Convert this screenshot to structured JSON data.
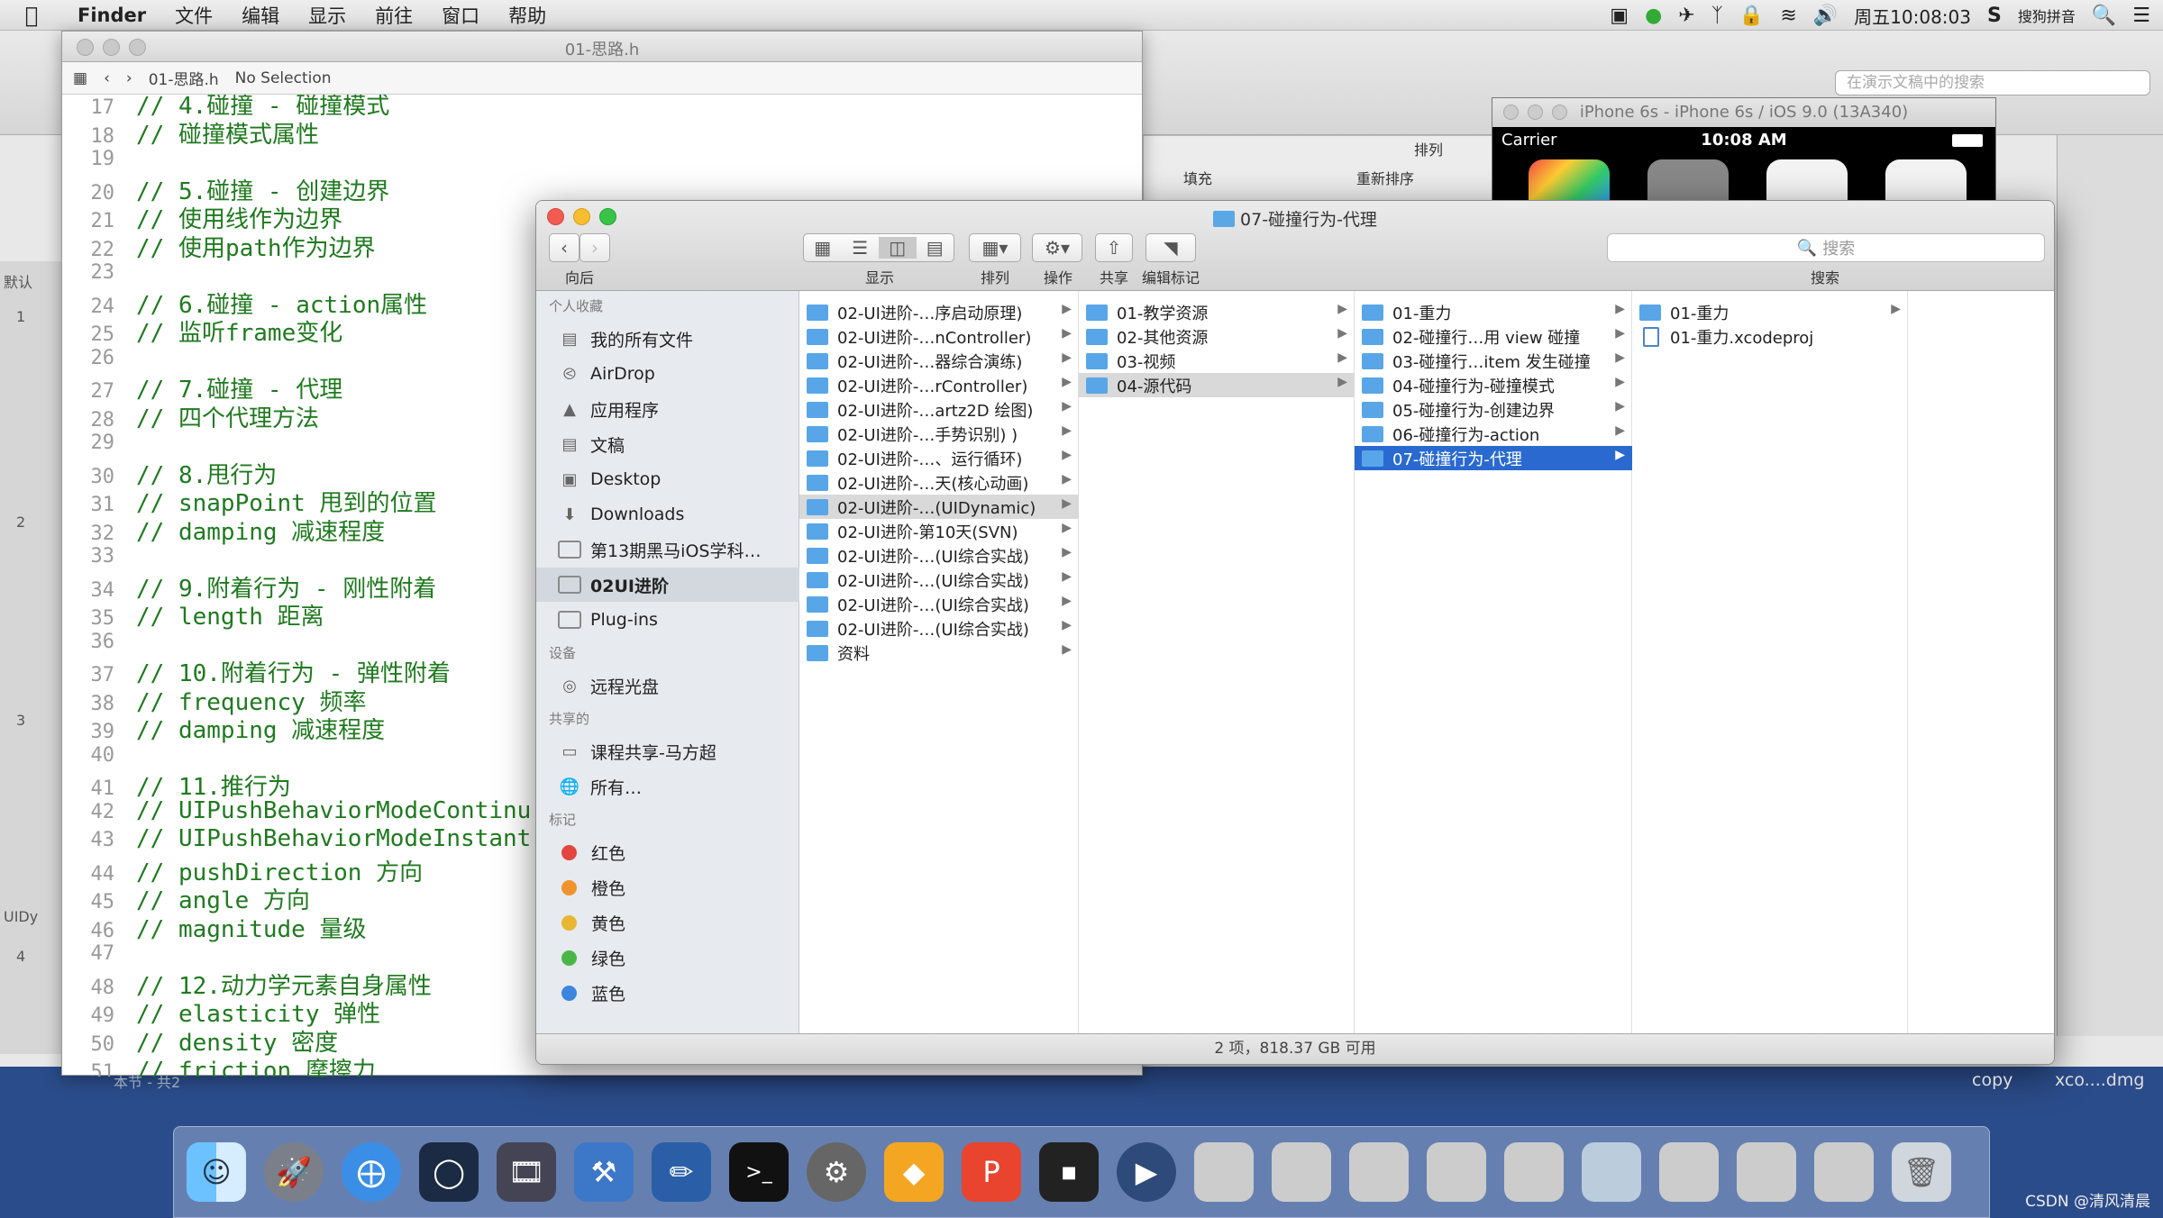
{
  "menubar": {
    "app": "Finder",
    "items": [
      "文件",
      "编辑",
      "显示",
      "前往",
      "窗口",
      "帮助"
    ],
    "clock": "周五10:08:03",
    "input_method": "搜狗拼音"
  },
  "background_app": {
    "search_placeholder": "在演示文稿中的搜索",
    "fmt_fill": "填充",
    "fmt_group": "排列",
    "fmt_reorder": "重新排序",
    "left_rail": {
      "section1": "默认",
      "section2": "UIDy",
      "nums": [
        "1",
        "2",
        "3",
        "4"
      ]
    },
    "footer_note": "本节 - 共2"
  },
  "xcode": {
    "title": "01-思路.h",
    "jump_file": "01-思路.h",
    "jump_selection": "No Selection",
    "lines": [
      {
        "n": "17",
        "t": "// 4.碰撞 - 碰撞模式"
      },
      {
        "n": "18",
        "t": "// 碰撞模式属性"
      },
      {
        "n": "19",
        "t": ""
      },
      {
        "n": "20",
        "t": "// 5.碰撞 - 创建边界"
      },
      {
        "n": "21",
        "t": "// 使用线作为边界"
      },
      {
        "n": "22",
        "t": "// 使用path作为边界"
      },
      {
        "n": "23",
        "t": ""
      },
      {
        "n": "24",
        "t": "// 6.碰撞 - action属性"
      },
      {
        "n": "25",
        "t": "// 监听frame变化"
      },
      {
        "n": "26",
        "t": ""
      },
      {
        "n": "27",
        "t": "// 7.碰撞 - 代理"
      },
      {
        "n": "28",
        "t": "// 四个代理方法"
      },
      {
        "n": "29",
        "t": ""
      },
      {
        "n": "30",
        "t": "// 8.甩行为"
      },
      {
        "n": "31",
        "t": "// snapPoint 甩到的位置"
      },
      {
        "n": "32",
        "t": "// damping 减速程度"
      },
      {
        "n": "33",
        "t": ""
      },
      {
        "n": "34",
        "t": "// 9.附着行为 - 刚性附着"
      },
      {
        "n": "35",
        "t": "// length 距离"
      },
      {
        "n": "36",
        "t": ""
      },
      {
        "n": "37",
        "t": "// 10.附着行为 - 弹性附着"
      },
      {
        "n": "38",
        "t": "// frequency 频率"
      },
      {
        "n": "39",
        "t": "// damping 减速程度"
      },
      {
        "n": "40",
        "t": ""
      },
      {
        "n": "41",
        "t": "// 11.推行为"
      },
      {
        "n": "42",
        "t": "// UIPushBehaviorModeContinu"
      },
      {
        "n": "43",
        "t": "// UIPushBehaviorModeInstant"
      },
      {
        "n": "44",
        "t": "// pushDirection 方向"
      },
      {
        "n": "45",
        "t": "// angle 方向"
      },
      {
        "n": "46",
        "t": "// magnitude 量级"
      },
      {
        "n": "47",
        "t": ""
      },
      {
        "n": "48",
        "t": "// 12.动力学元素自身属性"
      },
      {
        "n": "49",
        "t": "// elasticity 弹性"
      },
      {
        "n": "50",
        "t": "// density 密度"
      },
      {
        "n": "51",
        "t": "// friction 摩擦力"
      }
    ]
  },
  "simulator": {
    "title": "iPhone 6s - iPhone 6s / iOS 9.0 (13A340)",
    "carrier": "Carrier",
    "time": "10:08 AM"
  },
  "finder": {
    "title": "07-碰撞行为-代理",
    "toolbar": {
      "back_label": "向后",
      "view_label": "显示",
      "arrange_label": "排列",
      "action_label": "操作",
      "share_label": "共享",
      "tags_label": "编辑标记",
      "search_label": "搜索",
      "search_placeholder": "搜索"
    },
    "sidebar": {
      "favorites_head": "个人收藏",
      "favorites": [
        "我的所有文件",
        "AirDrop",
        "应用程序",
        "文稿",
        "Desktop",
        "Downloads",
        "第13期黑马iOS学科…",
        "02UI进阶",
        "Plug-ins"
      ],
      "devices_head": "设备",
      "devices": [
        "远程光盘"
      ],
      "shared_head": "共享的",
      "shared": [
        "课程共享-马方超",
        "所有…"
      ],
      "tags_head": "标记",
      "tags": [
        {
          "name": "红色",
          "color": "#e2463f"
        },
        {
          "name": "橙色",
          "color": "#f0922e"
        },
        {
          "name": "黄色",
          "color": "#e8b632"
        },
        {
          "name": "绿色",
          "color": "#4bb648"
        },
        {
          "name": "蓝色",
          "color": "#3d86e0"
        }
      ]
    },
    "col1": [
      "02-UI进阶-…序启动原理)",
      "02-UI进阶-…nController)",
      "02-UI进阶-…器综合演练)",
      "02-UI进阶-…rController)",
      "02-UI进阶-…artz2D 绘图)",
      "02-UI进阶-…手势识别) )",
      "02-UI进阶-…、运行循环)",
      "02-UI进阶-…天(核心动画)",
      "02-UI进阶-…(UIDynamic)",
      "02-UI进阶-第10天(SVN)",
      "02-UI进阶-…(UI综合实战)",
      "02-UI进阶-…(UI综合实战)",
      "02-UI进阶-…(UI综合实战)",
      "02-UI进阶-…(UI综合实战)",
      "资料"
    ],
    "col2": [
      "01-教学资源",
      "02-其他资源",
      "03-视频",
      "04-源代码"
    ],
    "col3": [
      "01-重力",
      "02-碰撞行…用 view 碰撞",
      "03-碰撞行…item 发生碰撞",
      "04-碰撞行为-碰撞模式",
      "05-碰撞行为-创建边界",
      "06-碰撞行为-action",
      "07-碰撞行为-代理"
    ],
    "col4": [
      {
        "name": "01-重力",
        "kind": "folder"
      },
      {
        "name": "01-重力.xcodeproj",
        "kind": "file"
      }
    ],
    "status": "2 项，818.37 GB 可用"
  },
  "desktop": {
    "copy_label": "copy",
    "dmg_label": "xco....dmg",
    "watermark": "CSDN @清风清晨"
  },
  "colors": {
    "selection_blue": "#2a6ad0",
    "folder_blue": "#58a6e8",
    "code_green": "#1f7a1f"
  }
}
